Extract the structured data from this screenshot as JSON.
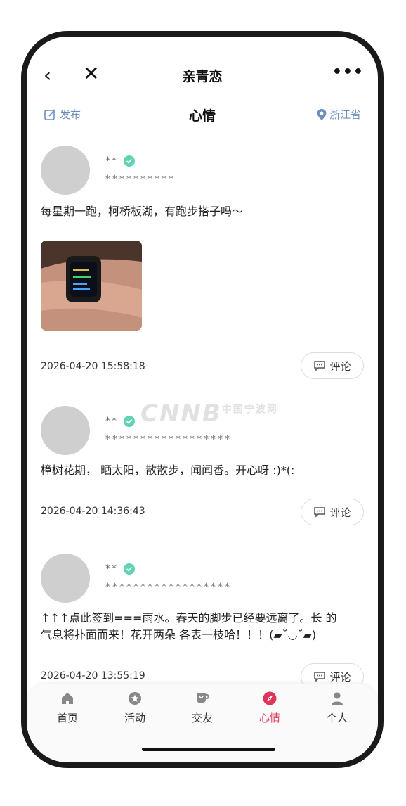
{
  "app": {
    "title": "亲青恋",
    "back_icon": "chevron-left-icon",
    "close_icon": "close-icon",
    "more_icon": "more-dots-icon"
  },
  "subnav": {
    "publish_label": "发布",
    "title": "心情",
    "location_label": "浙江省"
  },
  "posts": [
    {
      "name": "**",
      "id": "**********",
      "content": "每星期一跑，柯桥板湖，有跑步搭子吗～",
      "has_image": true,
      "timestamp": "2026-04-20 15:58:18",
      "comment_label": "评论"
    },
    {
      "name": "**",
      "id": "******************",
      "content": "樟树花期， 晒太阳，散散步，闻闻香。开心呀 :)*(: ",
      "has_image": false,
      "timestamp": "2026-04-20 14:36:43",
      "comment_label": "评论"
    },
    {
      "name": "**",
      "id": "******************",
      "content_line1": "↑↑↑点此签到===雨水。春天的脚步已经要远离了。长 的",
      "content_line2": "气息将扑面而来！花开两朵 各表一枝哈！！！(▰˘◡˘▰)",
      "has_image": false,
      "timestamp": "2026-04-20 13:55:19",
      "comment_label": "评论"
    }
  ],
  "watermark": "CNNB",
  "watermark_small": "中国宁波网",
  "tabbar": {
    "items": [
      {
        "label": "首页",
        "icon": "home-icon",
        "active": false
      },
      {
        "label": "活动",
        "icon": "star-circle-icon",
        "active": false
      },
      {
        "label": "交友",
        "icon": "cup-icon",
        "active": false
      },
      {
        "label": "心情",
        "icon": "compass-icon",
        "active": true
      },
      {
        "label": "个人",
        "icon": "person-icon",
        "active": false
      }
    ]
  },
  "colors": {
    "accent": "#e0355a",
    "link_blue": "#6c8fbf",
    "verified_green": "#5fd3b3"
  }
}
